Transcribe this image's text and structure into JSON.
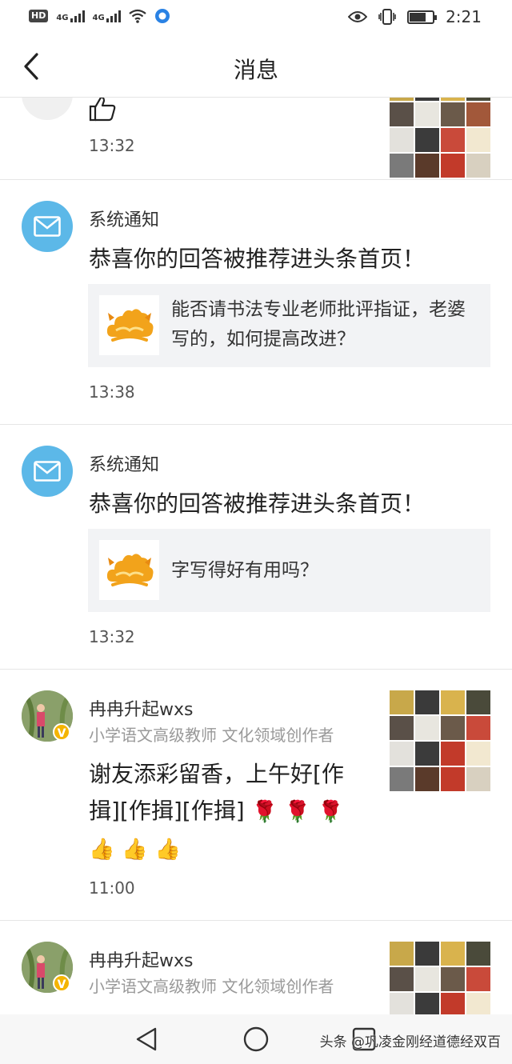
{
  "status_bar": {
    "hd_label": "HD",
    "sim1": "4G",
    "sim2": "4G",
    "time": "2:21",
    "battery_level": 0.7
  },
  "header": {
    "title": "消息"
  },
  "messages": [
    {
      "type": "partial",
      "time": "13:32"
    },
    {
      "type": "system",
      "name": "系统通知",
      "text": "恭喜你的回答被推荐进头条首页！",
      "card_text": "能否请书法专业老师批评指证，老婆写的，如何提高改进？",
      "time": "13:38"
    },
    {
      "type": "system",
      "name": "系统通知",
      "text": "恭喜你的回答被推荐进头条首页！",
      "card_text": "字写得好有用吗？",
      "time": "13:32"
    },
    {
      "type": "user",
      "name": "冉冉升起wxs",
      "subtitle": "小学语文高级教师 文化领域创作者",
      "text": "谢友添彩留香，上午好[作揖][作揖][作揖]",
      "time": "11:00"
    },
    {
      "type": "user",
      "name": "冉冉升起wxs",
      "subtitle": "小学语文高级教师 文化领域创作者"
    }
  ],
  "icons": {
    "back": "chevron-left-icon",
    "mail": "mail-icon",
    "like": "thumbs-up-icon",
    "verified": "verified-badge-icon",
    "rose": "rose-emoji",
    "thumbs": "thumbs-up-emoji"
  },
  "verified_badge": "V",
  "colors": {
    "mail_avatar": "#5cb8e8",
    "card_bg": "#f2f3f5",
    "badge": "#f4b400"
  },
  "watermark": "头条 @巩凌金刚经道德经双百"
}
